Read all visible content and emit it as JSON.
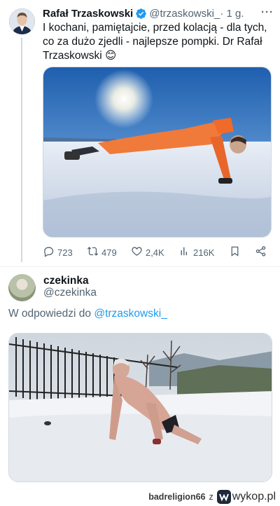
{
  "tweet": {
    "author_name": "Rafał Trzaskowski",
    "handle": "@trzaskowski_",
    "time": "· 1 g.",
    "more_icon": "more-dots-icon",
    "text": "I kochani, pamiętajcie, przed kolacją - dla tych, co za dużo zjedli - najlepsze pompki. Dr Rafał Trzaskowski 😊",
    "stats": {
      "replies": "723",
      "retweets": "479",
      "likes": "2,4K",
      "views": "216K"
    },
    "colors": {
      "verified": "#1d9bf0",
      "muted": "#536471"
    }
  },
  "reply": {
    "author_name": "czekinka",
    "handle": "@czekinka",
    "reply_prefix": "W odpowiedzi do",
    "reply_mention": "@trzaskowski_",
    "link_color": "#1d9bf0"
  },
  "footer": {
    "source": "badreligion66",
    "z": "z",
    "site": "wykop.pl"
  }
}
